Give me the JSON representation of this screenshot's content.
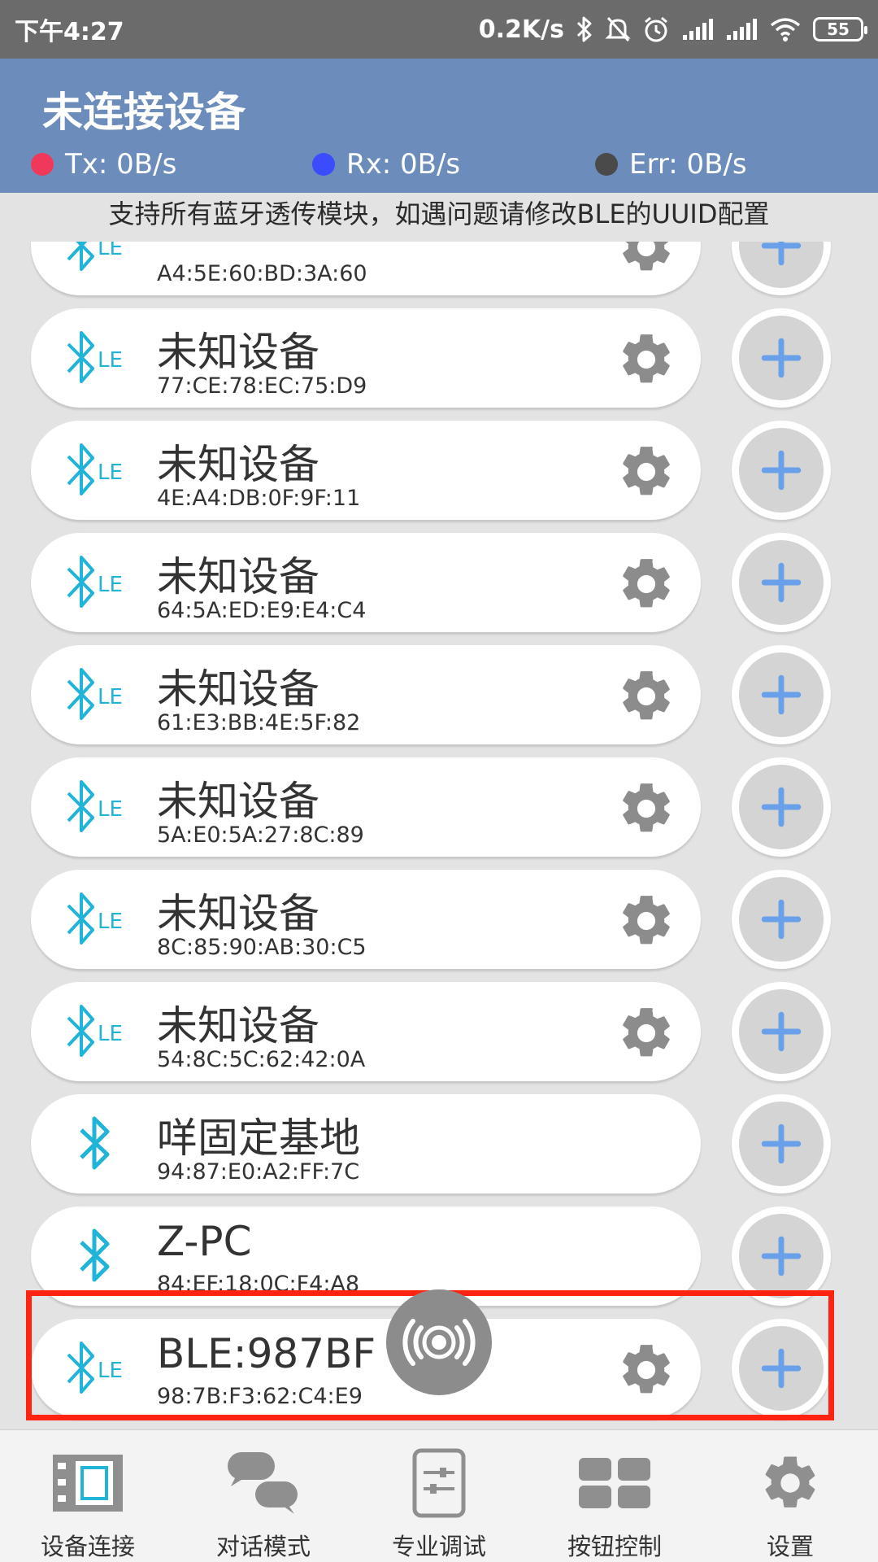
{
  "status_bar": {
    "time": "下午4:27",
    "net_speed": "0.2K/s",
    "battery": "55",
    "icons": [
      "bluetooth-icon",
      "mute-bell-icon",
      "alarm-icon",
      "signal-icon",
      "signal-icon",
      "wifi-icon",
      "battery-icon"
    ]
  },
  "header": {
    "title": "未连接设备",
    "tx": "Tx: 0B/s",
    "rx": "Rx: 0B/s",
    "err": "Err: 0B/s",
    "tx_color": "#f0385a",
    "rx_color": "#3b4cff",
    "err_color": "#4a4a4a"
  },
  "notice": "支持所有蓝牙透传模块，如遇问题请修改BLE的UUID配置",
  "devices": [
    {
      "name": "",
      "mac": "A4:5E:60:BD:3A:60",
      "ble": true
    },
    {
      "name": "未知设备",
      "mac": "77:CE:78:EC:75:D9",
      "ble": true
    },
    {
      "name": "未知设备",
      "mac": "4E:A4:DB:0F:9F:11",
      "ble": true
    },
    {
      "name": "未知设备",
      "mac": "64:5A:ED:E9:E4:C4",
      "ble": true
    },
    {
      "name": "未知设备",
      "mac": "61:E3:BB:4E:5F:82",
      "ble": true
    },
    {
      "name": "未知设备",
      "mac": "5A:E0:5A:27:8C:89",
      "ble": true
    },
    {
      "name": "未知设备",
      "mac": "8C:85:90:AB:30:C5",
      "ble": true
    },
    {
      "name": "未知设备",
      "mac": "54:8C:5C:62:42:0A",
      "ble": true
    },
    {
      "name": "咩固定基地",
      "mac": "94:87:E0:A2:FF:7C",
      "ble": false
    },
    {
      "name": "Z-PC",
      "mac": "84:EF:18:0C:F4:A8",
      "ble": false
    },
    {
      "name": "BLE:987BF",
      "mac": "98:7B:F3:62:C4:E9",
      "ble": true
    }
  ],
  "bottom_nav": [
    {
      "label": "设备连接",
      "icon": "device-connect-icon",
      "active": true
    },
    {
      "label": "对话模式",
      "icon": "chat-icon",
      "active": false
    },
    {
      "label": "专业调试",
      "icon": "debug-icon",
      "active": false
    },
    {
      "label": "按钮控制",
      "icon": "grid-buttons-icon",
      "active": false
    },
    {
      "label": "设置",
      "icon": "gear-icon",
      "active": false
    }
  ],
  "colors": {
    "header_bg": "#6c8cbb",
    "bluetooth": "#1fb4d8",
    "plus": "#6aa0ea",
    "gear": "#8c8c8c",
    "highlight": "#ff2410"
  }
}
